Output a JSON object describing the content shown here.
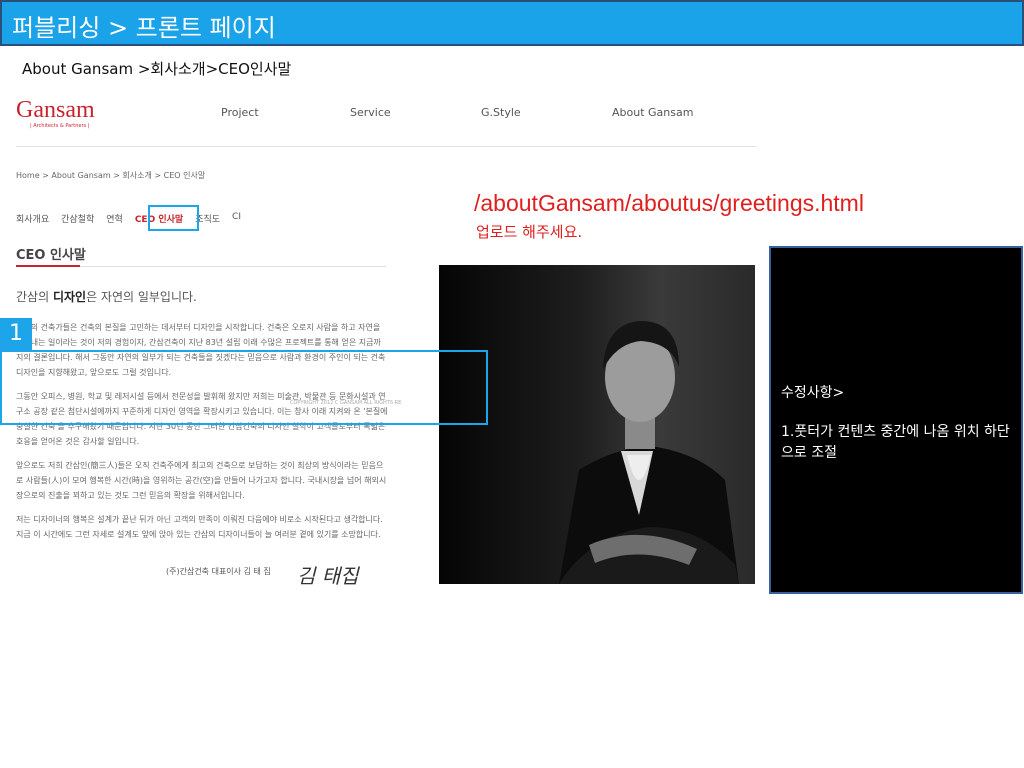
{
  "slide": {
    "title": "퍼블리싱 > 프론트 페이지",
    "breadcrumb": "About Gansam >회사소개>CEO인사말"
  },
  "site": {
    "logo": "Gansam",
    "logo_sub": "| Architects & Partners |",
    "nav": [
      "Project",
      "Service",
      "G.Style",
      "About Gansam"
    ],
    "crumb": "Home > About Gansam > 회사소개 > CEO 인사말",
    "subnav": [
      {
        "label": "회사개요",
        "active": false
      },
      {
        "label": "간삼철학",
        "active": false
      },
      {
        "label": "연혁",
        "active": false
      },
      {
        "label": "CEO 인사말",
        "active": true
      },
      {
        "label": "조직도",
        "active": false
      },
      {
        "label": "CI",
        "active": false
      }
    ],
    "section_title": "CEO 인사말",
    "headline_pre": "간삼의 ",
    "headline_bold": "디자인",
    "headline_post": "은 자연의 일부입니다.",
    "paragraphs": [
      "건축의 건축가들은 건축의 본질을 고민하는 데서부터 디자인을 시작합니다. 건축은 오로지 사람을 하고 자연을 담아내는 일이라는 것이 저의 경험이자, 간삼건축이 지난 83년 설립 이래 수많은 프로젝트를 통해 얻은 지금까지의 결론입니다. 해서 그동안 자연의 일부가 되는 건축들을 짓겠다는 믿음으로 사람과 환경이 주인이 되는 건축 디자인을 지향해왔고, 앞으로도 그럴 것입니다.",
      "그동안 오피스, 병원, 학교 및 레저시설 등에서 전문성을 발휘해 왔지만 저희는 미술관, 박물관 등 문화시설과 연구소 공장 같은 첨단시설에까지 꾸준하게 디자인 영역을 확장시키고 있습니다. 이는 창사 이래 지켜와 온 '본질에 충실한 건축'을 추구해왔기 때문입니다. 지난 30년 동안 그러한 간삼건축의 디자인 철학이 고객들로부터 폭넓은 호응을 얻어온 것은 감사할 일입니다.",
      "앞으로도 저희 간삼인(簡三人)들은 오직 건축주에게 최고의 건축으로 보답하는 것이 최상의 방식이라는 믿음으로 사람들(人)이 모여 행복한 시간(時)을 영위하는 공간(空)을 만들어 나가고자 합니다. 국내시장을 넘어 해외시장으로의 진출을 꾀하고 있는 것도 그런 믿음의 확장을 위해서입니다.",
      "저는 디자이너의 행복은 설계가 끝난 뒤가 아닌 고객의 만족이 이뤄진 다음에야 비로소 시작된다고 생각합니다. 지금 이 시간에도 그런 자세로 설계도 앞에 앉아 있는 간삼의 디자이너들이 늘 여러분 곁에 있기를 소망합니다."
    ],
    "signature": "(주)간삼건축 대표이사 김 태 집",
    "signature_script": "김 태집",
    "copyright": "COPYRIGHT 2012 C GANSAM ALL RIGHTS RE"
  },
  "annotation": {
    "url": "/aboutGansam/aboutus/greetings.html",
    "url_note": "업로드 해주세요.",
    "marker_number": "1",
    "notes_title": "수정사항>",
    "notes_body": "1.풋터가 컨텐츠 중간에 나옴 위치 하단으로 조절"
  },
  "colors": {
    "header_bg": "#1aa3e8",
    "brand_red": "#c8242f",
    "annotation_blue": "#1ea4e9",
    "annotation_red": "#e01f1f"
  }
}
